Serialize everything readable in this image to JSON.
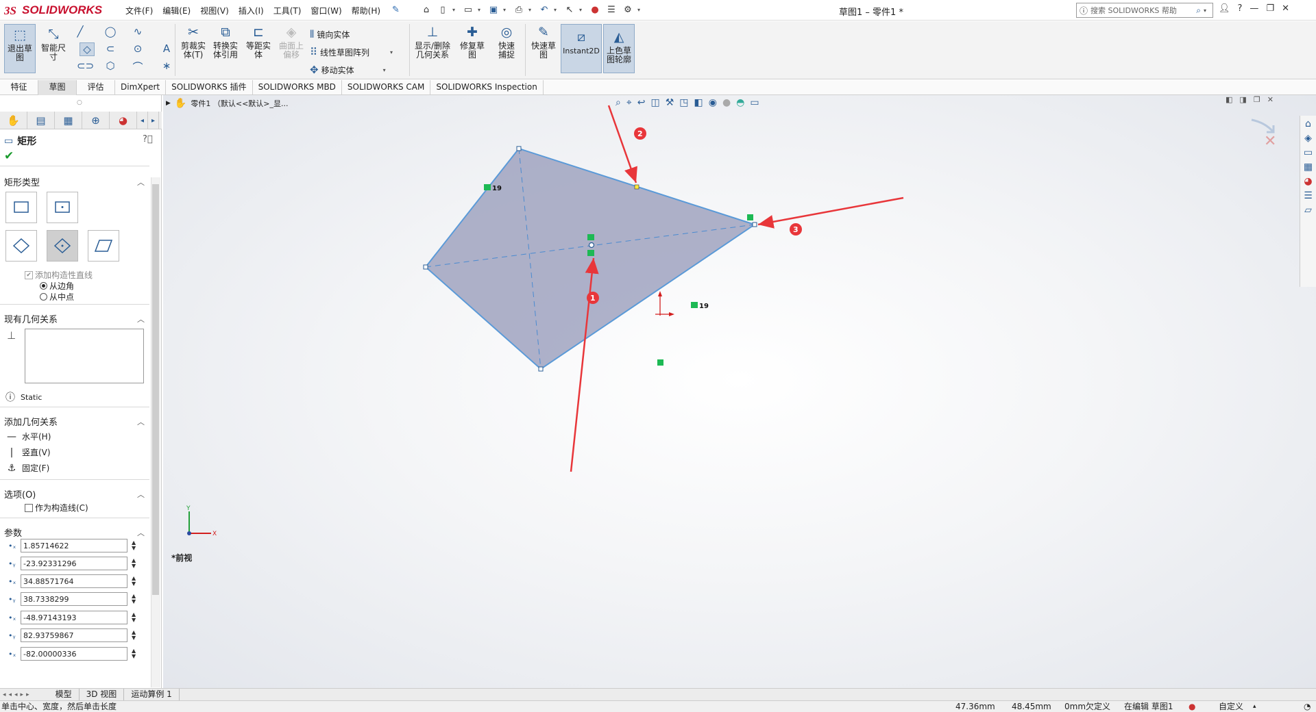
{
  "app": {
    "name": "SOLIDWORKS",
    "doc_title": "草图1 – 零件1 *"
  },
  "menu": [
    "文件(F)",
    "编辑(E)",
    "视图(V)",
    "插入(I)",
    "工具(T)",
    "窗口(W)",
    "帮助(H)"
  ],
  "search": {
    "placeholder": "搜索 SOLIDWORKS 帮助"
  },
  "ribbon": {
    "exit_sketch": "退出草图",
    "smart_dim": "智能尺寸",
    "trim": "剪裁实体(T)",
    "convert": "转换实体引用",
    "offset": "等距实体",
    "surface_offset": "曲面上偏移",
    "mirror": "镜向实体",
    "linear_pattern": "线性草图阵列",
    "move": "移动实体",
    "show_relations": "显示/删除几何关系",
    "repair": "修复草图",
    "quick_snap": "快速捕捉",
    "rapid_sketch": "快速草图",
    "instant2d": "Instant2D",
    "shaded": "上色草图轮廓"
  },
  "cm_tabs": [
    "特征",
    "草图",
    "评估",
    "DimXpert",
    "SOLIDWORKS 插件",
    "SOLIDWORKS MBD",
    "SOLIDWORKS CAM",
    "SOLIDWORKS Inspection"
  ],
  "panel": {
    "title": "矩形",
    "rect_type": "矩形类型",
    "add_construction": "添加构造性直线",
    "from_corner": "从边角",
    "from_midpoint": "从中点",
    "existing_relations": "现有几何关系",
    "status_label": "Static",
    "add_relations": "添加几何关系",
    "horizontal": "水平(H)",
    "vertical": "竖直(V)",
    "fix": "固定(F)",
    "options": "选项(O)",
    "as_construction": "作为构造线(C)",
    "params": "参数",
    "values": [
      "1.85714622",
      "-23.92331296",
      "34.88571764",
      "38.7338299",
      "-48.97143193",
      "82.93759867",
      "-82.00000336"
    ]
  },
  "tree_breadcrumb": "零件1 （默认<<默认>_显...",
  "view_label": "*前视",
  "markers": {
    "relation_num_a": "19",
    "relation_num_b": "19",
    "arrow_1": "1",
    "arrow_2": "2",
    "arrow_3": "3"
  },
  "bottom_tabs": [
    "模型",
    "3D 视图",
    "运动算例 1"
  ],
  "status": {
    "hint": "单击中心、宽度，然后单击长度",
    "x": "47.36mm",
    "y": "48.45mm",
    "z": "0mm",
    "defined": "欠定义",
    "editing": "在编辑 草图1",
    "units": "自定义"
  },
  "colors": {
    "rect_fill": "#a0a3bf",
    "rect_edge": "#5a9ad8",
    "arrow_red": "#e8363a",
    "relation_green": "#1db954"
  }
}
